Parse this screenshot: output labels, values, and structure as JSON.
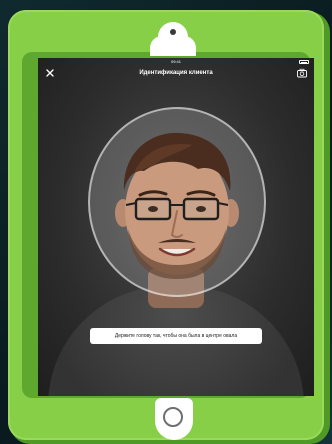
{
  "status_bar": {
    "time": "09:41"
  },
  "nav": {
    "title": "Идентификация клиента",
    "close_icon": "close-icon",
    "camera_icon": "camera-icon"
  },
  "hint": {
    "text": "Держите голову так, чтобы она была в центре овала"
  },
  "colors": {
    "case_green": "#86cf47",
    "screen_bg": "#2c2c2c",
    "hint_bg": "#ffffff"
  }
}
